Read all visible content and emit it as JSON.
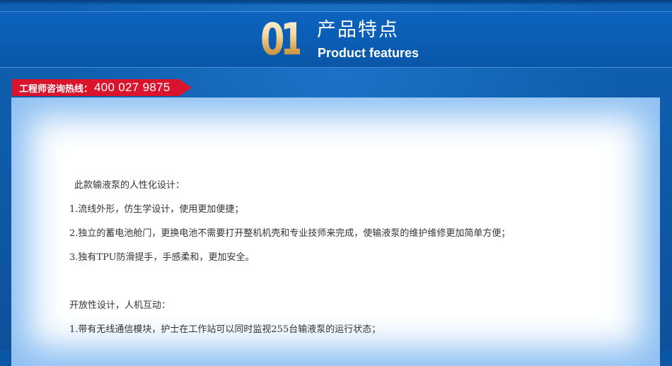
{
  "header": {
    "number": "01",
    "title_cn": "产品特点",
    "title_en": "Product features"
  },
  "hotline": {
    "label": "工程师咨询热线：",
    "number": "400 027 9875"
  },
  "content": {
    "intro": "此款输液泵的人性化设计：",
    "item1": "1.流线外形，仿生学设计，使用更加便捷；",
    "item2": "2.独立的蓄电池舱门，更换电池不需要打开整机机壳和专业技师来完成，使输液泵的维护维修更加简单方便；",
    "item3": "3.独有TPU防滑提手，手感柔和，更加安全。",
    "section2_title": "开放性设计，人机互动：",
    "section2_item1": "1.带有无线通信模块，护士在工作站可以同时监视255台输液泵的运行状态；"
  },
  "colors": {
    "background_blue": "#0a57a8",
    "hotline_red": "#d9142c",
    "number_gold": "#d7a452",
    "text_gray": "#333333"
  }
}
